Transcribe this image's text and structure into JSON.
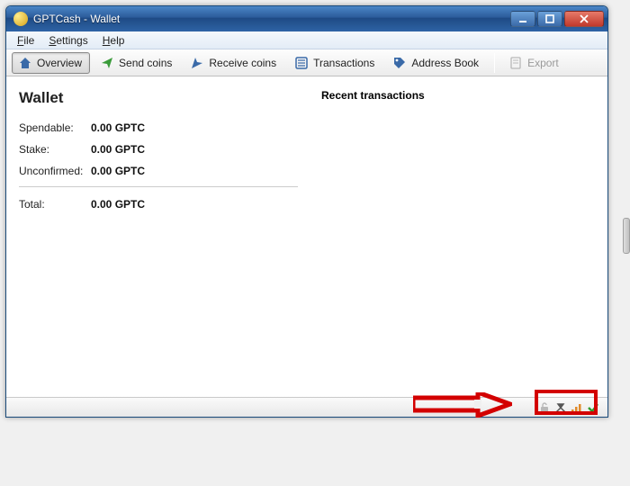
{
  "window": {
    "title": "GPTCash - Wallet"
  },
  "menu": {
    "file": "File",
    "settings": "Settings",
    "help": "Help"
  },
  "toolbar": {
    "overview": "Overview",
    "send": "Send coins",
    "receive": "Receive coins",
    "transactions": "Transactions",
    "addressbook": "Address Book",
    "export": "Export"
  },
  "wallet": {
    "heading": "Wallet",
    "rows": {
      "spendable_label": "Spendable:",
      "spendable_value": "0.00 GPTC",
      "stake_label": "Stake:",
      "stake_value": "0.00 GPTC",
      "unconfirmed_label": "Unconfirmed:",
      "unconfirmed_value": "0.00 GPTC",
      "total_label": "Total:",
      "total_value": "0.00 GPTC"
    }
  },
  "recent": {
    "heading": "Recent transactions"
  },
  "status": {
    "icons": [
      "lock-open-icon",
      "hammer-pick-icon",
      "network-bars-icon",
      "check-icon"
    ]
  },
  "colors": {
    "titlebar_start": "#4b86c7",
    "titlebar_end": "#2e63a5",
    "close_btn": "#c0392b",
    "annotation": "#d30000",
    "check": "#2e9b2e"
  }
}
